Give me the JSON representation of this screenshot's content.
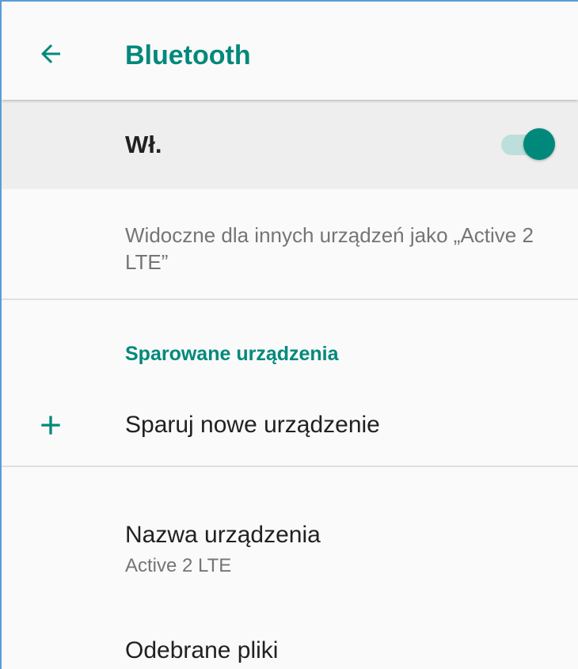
{
  "colors": {
    "accent": "#00897b",
    "switch_track": "#80cbc4",
    "text_primary": "#212121",
    "text_secondary": "#757575"
  },
  "app_bar": {
    "back_icon": "arrow-left-icon",
    "title": "Bluetooth"
  },
  "master_switch": {
    "label": "Wł.",
    "state": "on"
  },
  "visibility_text": "Widoczne dla innych urządzeń jako „Active 2 LTE”",
  "paired_section": {
    "header": "Sparowane urządzenia"
  },
  "pair_new": {
    "icon": "plus-icon",
    "label": "Sparuj nowe urządzenie"
  },
  "device_name": {
    "title": "Nazwa urządzenia",
    "summary": "Active 2 LTE"
  },
  "received_files": {
    "title": "Odebrane pliki"
  }
}
